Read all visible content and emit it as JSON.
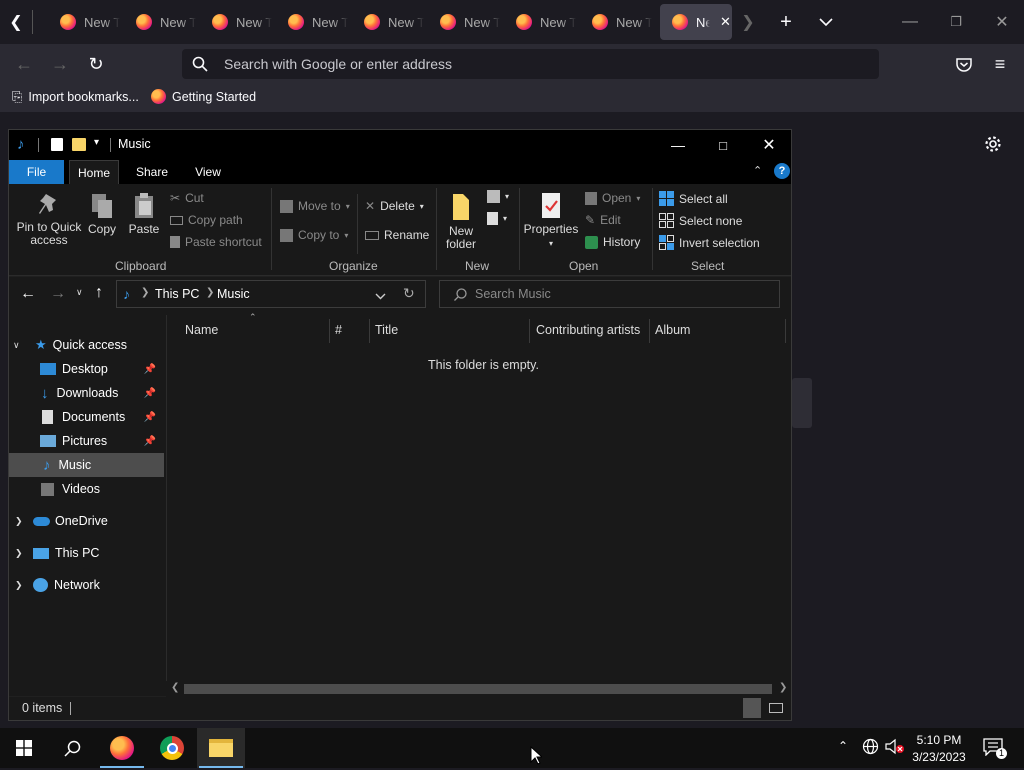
{
  "browser": {
    "tabs": [
      {
        "label": "New Tab"
      },
      {
        "label": "New Tab"
      },
      {
        "label": "New Tab"
      },
      {
        "label": "New Tab"
      },
      {
        "label": "New Tab"
      },
      {
        "label": "New Tab"
      },
      {
        "label": "New Tab"
      },
      {
        "label": "New Tab"
      },
      {
        "label": "New Tab"
      }
    ],
    "url_placeholder": "Search with Google or enter address",
    "bookmarks": [
      {
        "label": "Import bookmarks..."
      },
      {
        "label": "Getting Started"
      }
    ]
  },
  "explorer": {
    "title": "Music",
    "ribbon_tabs": [
      "File",
      "Home",
      "Share",
      "View"
    ],
    "clipboard": {
      "label": "Clipboard",
      "pin": "Pin to Quick access",
      "copy": "Copy",
      "paste": "Paste",
      "cut": "Cut",
      "copy_path": "Copy path",
      "paste_shortcut": "Paste shortcut"
    },
    "organize": {
      "label": "Organize",
      "move_to": "Move to",
      "copy_to": "Copy to",
      "delete": "Delete",
      "rename": "Rename"
    },
    "new": {
      "label": "New",
      "new_folder": "New folder"
    },
    "open": {
      "label": "Open",
      "properties": "Properties",
      "open": "Open",
      "edit": "Edit",
      "history": "History"
    },
    "select": {
      "label": "Select",
      "select_all": "Select all",
      "select_none": "Select none",
      "invert": "Invert selection"
    },
    "breadcrumb": [
      "This PC",
      "Music"
    ],
    "search_placeholder": "Search Music",
    "nav": {
      "quick_access": "Quick access",
      "items": [
        {
          "label": "Desktop",
          "pinned": true
        },
        {
          "label": "Downloads",
          "pinned": true
        },
        {
          "label": "Documents",
          "pinned": true
        },
        {
          "label": "Pictures",
          "pinned": true
        },
        {
          "label": "Music",
          "pinned": false
        },
        {
          "label": "Videos",
          "pinned": false
        }
      ],
      "onedrive": "OneDrive",
      "this_pc": "This PC",
      "network": "Network"
    },
    "columns": [
      "Name",
      "#",
      "Title",
      "Contributing artists",
      "Album"
    ],
    "empty_message": "This folder is empty.",
    "status": "0 items"
  },
  "taskbar": {
    "time": "5:10 PM",
    "date": "3/23/2023",
    "notification_count": "1"
  },
  "colors": {
    "accent": "#1979ca",
    "firefox_bg": "#1c1b22",
    "explorer_bg": "#191919"
  }
}
